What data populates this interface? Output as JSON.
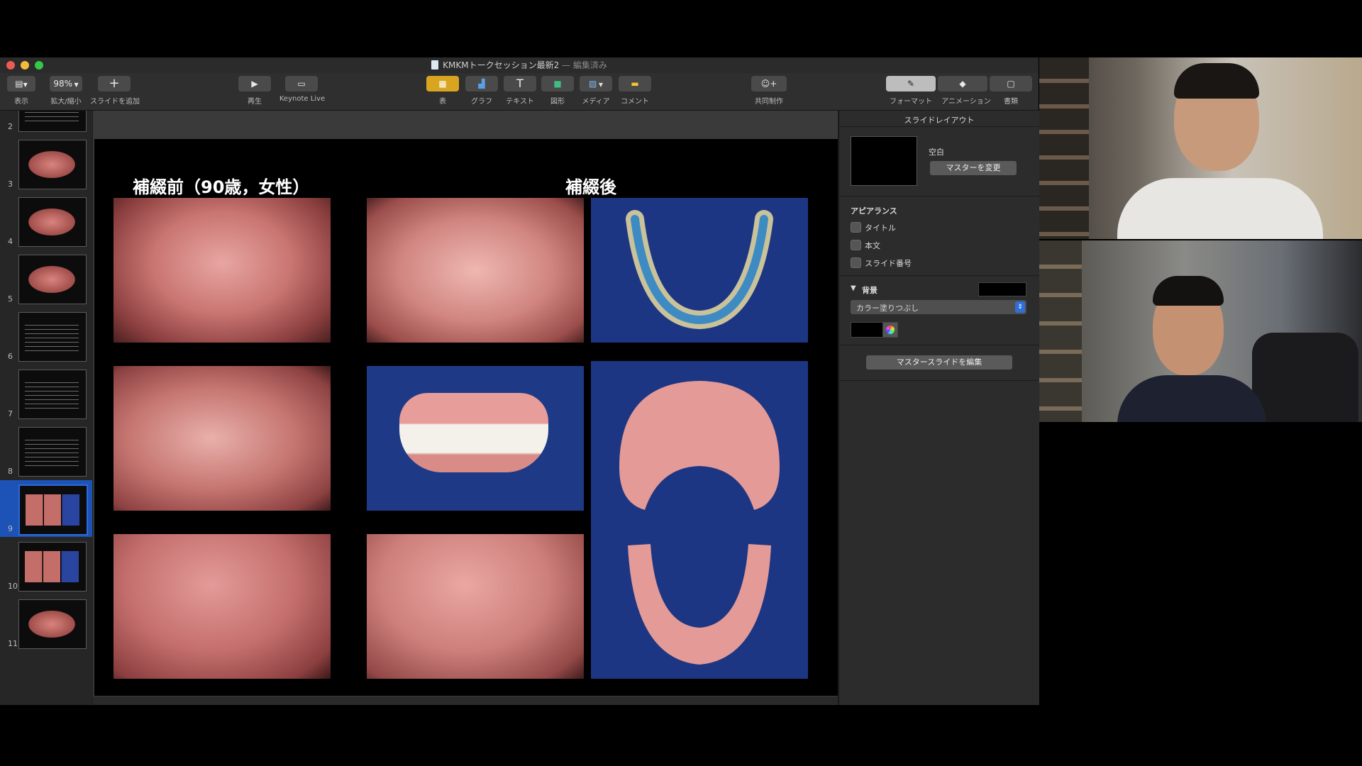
{
  "window": {
    "title": "KMKMトークセッション最新2",
    "edited": "— 編集済み"
  },
  "toolbar": {
    "view_label": "表示",
    "zoom_value": "98%",
    "zoom_label": "拡大/縮小",
    "add_slide_label": "スライドを追加",
    "play_label": "再生",
    "keynote_live_label": "Keynote Live",
    "table_label": "表",
    "chart_label": "グラフ",
    "text_label": "テキスト",
    "shape_label": "図形",
    "media_label": "メディア",
    "comment_label": "コメント",
    "collaborate_label": "共同制作",
    "format_label": "フォーマット",
    "animate_label": "アニメーション",
    "document_label": "書類"
  },
  "navigator": {
    "slides": [
      {
        "num": "2"
      },
      {
        "num": "3"
      },
      {
        "num": "4"
      },
      {
        "num": "5"
      },
      {
        "num": "6"
      },
      {
        "num": "7"
      },
      {
        "num": "8"
      },
      {
        "num": "9"
      },
      {
        "num": "10"
      },
      {
        "num": "11"
      }
    ],
    "selected": "9"
  },
  "slide": {
    "title_before": "補綴前（90歳，女性）",
    "title_after": "補綴後"
  },
  "inspector": {
    "header": "スライドレイアウト",
    "layout_name": "空白",
    "change_master_button": "マスターを変更",
    "appearance_title": "アピアランス",
    "opt_title": "タイトル",
    "opt_body": "本文",
    "opt_slide_number": "スライド番号",
    "background_title": "背景",
    "fill_type": "カラー塗りつぶし",
    "edit_master_button": "マスタースライドを編集",
    "colors": {
      "background": "#000000"
    }
  }
}
